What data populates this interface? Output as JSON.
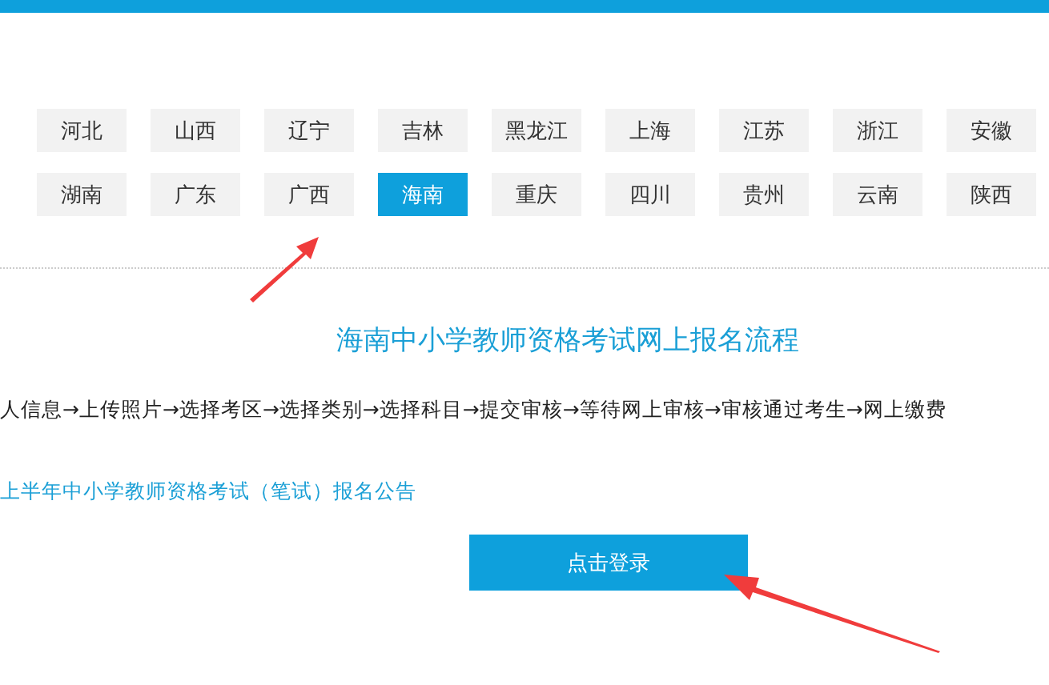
{
  "regions": [
    [
      {
        "label": "河北",
        "selected": false
      },
      {
        "label": "山西",
        "selected": false
      },
      {
        "label": "辽宁",
        "selected": false
      },
      {
        "label": "吉林",
        "selected": false
      },
      {
        "label": "黑龙江",
        "selected": false
      },
      {
        "label": "上海",
        "selected": false
      },
      {
        "label": "江苏",
        "selected": false
      },
      {
        "label": "浙江",
        "selected": false
      },
      {
        "label": "安徽",
        "selected": false
      }
    ],
    [
      {
        "label": "湖南",
        "selected": false
      },
      {
        "label": "广东",
        "selected": false
      },
      {
        "label": "广西",
        "selected": false
      },
      {
        "label": "海南",
        "selected": true
      },
      {
        "label": "重庆",
        "selected": false
      },
      {
        "label": "四川",
        "selected": false
      },
      {
        "label": "贵州",
        "selected": false
      },
      {
        "label": "云南",
        "selected": false
      },
      {
        "label": "陕西",
        "selected": false
      }
    ]
  ],
  "title": "海南中小学教师资格考试网上报名流程",
  "process": "人信息→上传照片→选择考区→选择类别→选择科目→提交审核→等待网上审核→审核通过考生→网上缴费",
  "notice_link": "上半年中小学教师资格考试（笔试）报名公告",
  "login_button": "点击登录"
}
